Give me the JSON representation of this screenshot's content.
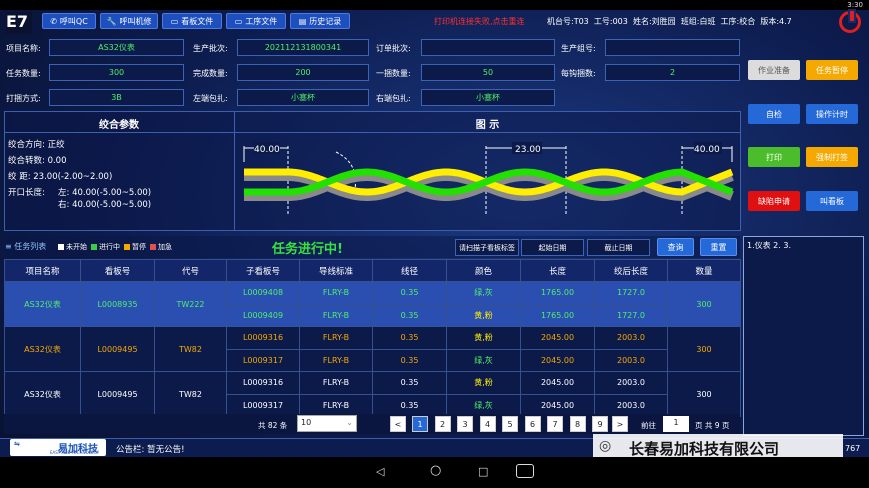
{
  "status_bar": {
    "time": "3:30"
  },
  "app": {
    "logo_text": "E7"
  },
  "toolbar": {
    "buttons": [
      "呼叫QC",
      "呼叫机修",
      "看板文件",
      "工序文件",
      "历史记录"
    ]
  },
  "header": {
    "warning": "打印机连接失败,点击重连",
    "machine_label": "机台号:",
    "machine": "T03",
    "workno_label": "工号:",
    "workno": "003",
    "name_label": "姓名:",
    "name": "刘胜园",
    "shift_label": "班组:",
    "shift": "白班",
    "process_label": "工序:",
    "process": "校合",
    "version_label": "版本:",
    "version": "4.7"
  },
  "form": {
    "row1": [
      {
        "label": "项目名称:",
        "value": "AS32仪表"
      },
      {
        "label": "生产批次:",
        "value": "202112131800341"
      },
      {
        "label": "订单批次:",
        "value": ""
      },
      {
        "label": "生产组号:",
        "value": ""
      }
    ],
    "row2": [
      {
        "label": "任务数量:",
        "value": "300"
      },
      {
        "label": "完成数量:",
        "value": "200"
      },
      {
        "label": "一捆数量:",
        "value": "50"
      },
      {
        "label": "每钩捆数:",
        "value": "2"
      }
    ],
    "row3": [
      {
        "label": "打捆方式:",
        "value": "3B"
      },
      {
        "label": "左端包扎:",
        "value": "小塞杯"
      },
      {
        "label": "右端包扎:",
        "value": "小塞杯"
      }
    ]
  },
  "side_buttons": [
    {
      "label": "作业准备",
      "color": "#dcdcdc",
      "text": "#555"
    },
    {
      "label": "任务暂停",
      "color": "#f5a800",
      "text": "#fff"
    },
    {
      "label": "自检",
      "color": "#2569d8",
      "text": "#fff"
    },
    {
      "label": "操作计时",
      "color": "#2569d8",
      "text": "#fff"
    },
    {
      "label": "打印",
      "color": "#4cbd2a",
      "text": "#fff"
    },
    {
      "label": "强制打签",
      "color": "#f5a800",
      "text": "#fff"
    },
    {
      "label": "缺陷申请",
      "color": "#e01010",
      "text": "#fff"
    },
    {
      "label": "叫看板",
      "color": "#2569d8",
      "text": "#fff"
    }
  ],
  "params": {
    "title": "绞合参数",
    "lines": [
      "绞合方向: 正绞",
      "绞合转数: 0.00",
      "绞      距: 23.00(-2.00~2.00)"
    ],
    "open_label": "开口长度:",
    "open_left": "左: 40.00(-5.00~5.00)",
    "open_right": "右: 40.00(-5.00~5.00)"
  },
  "diagram": {
    "title": "图  示",
    "left_dim": "40.00",
    "mid_dim": "23.00",
    "right_dim": "40.00",
    "colors": {
      "yellow": "#ffee00",
      "green": "#22e000",
      "gray": "#8a8a8a"
    }
  },
  "task": {
    "tab": "任务列表",
    "legend": [
      {
        "label": "未开始",
        "color": "#ffffff"
      },
      {
        "label": "进行中",
        "color": "#38d040"
      },
      {
        "label": "暂停",
        "color": "#f5a800"
      },
      {
        "label": "加急",
        "color": "#e05050"
      }
    ],
    "status": "任务进行中!",
    "scan_btn": "请扫描子看板标签",
    "start_date": "起始日期",
    "end_date": "截止日期",
    "query": "查询",
    "reset": "重置"
  },
  "table": {
    "headers": [
      "项目名称",
      "看板号",
      "代号",
      "子看板号",
      "导线标准",
      "线径",
      "颜色",
      "长度",
      "绞后长度",
      "数量"
    ],
    "groups": [
      {
        "project": "AS32仪表",
        "board": "L0008935",
        "code": "TW222",
        "qty": "300",
        "style": "active",
        "rows": [
          {
            "sub": "L0009408",
            "std": "FLRY-B",
            "dia": "0.35",
            "color": "绿,灰",
            "len": "1765.00",
            "after": "1727.0"
          },
          {
            "sub": "L0009409",
            "std": "FLRY-B",
            "dia": "0.35",
            "color": "黄,粉",
            "len": "1765.00",
            "after": "1727.0"
          }
        ]
      },
      {
        "project": "AS32仪表",
        "board": "L0009495",
        "code": "TW82",
        "qty": "300",
        "style": "paused",
        "rows": [
          {
            "sub": "L0009316",
            "std": "FLRY-B",
            "dia": "0.35",
            "color": "黄,粉",
            "len": "2045.00",
            "after": "2003.0"
          },
          {
            "sub": "L0009317",
            "std": "FLRY-B",
            "dia": "0.35",
            "color": "绿,灰",
            "len": "2045.00",
            "after": "2003.0"
          }
        ]
      },
      {
        "project": "AS32仪表",
        "board": "L0009495",
        "code": "TW82",
        "qty": "300",
        "style": "normal",
        "rows": [
          {
            "sub": "L0009316",
            "std": "FLRY-B",
            "dia": "0.35",
            "color": "黄,粉",
            "len": "2045.00",
            "after": "2003.0"
          },
          {
            "sub": "L0009317",
            "std": "FLRY-B",
            "dia": "0.35",
            "color": "绿,灰",
            "len": "2045.00",
            "after": "2003.0"
          }
        ]
      }
    ]
  },
  "note_box": {
    "text": "1.仪表 2. 3."
  },
  "pagination": {
    "total": "共 82 条",
    "page_size": "10",
    "pages": [
      "1",
      "2",
      "3",
      "4",
      "5",
      "6",
      "7",
      "8",
      "9"
    ],
    "current": "1",
    "goto_label": "前往",
    "goto_value": "1",
    "total_pages": "页 共 9 页"
  },
  "footer": {
    "company_logo": "易加科技",
    "company_logo_sub": "EASY ADD TECHNOLOGY",
    "notice": "公告栏: 暂无公告!",
    "watermark": "长春易加科技有限公司",
    "code": "767"
  }
}
